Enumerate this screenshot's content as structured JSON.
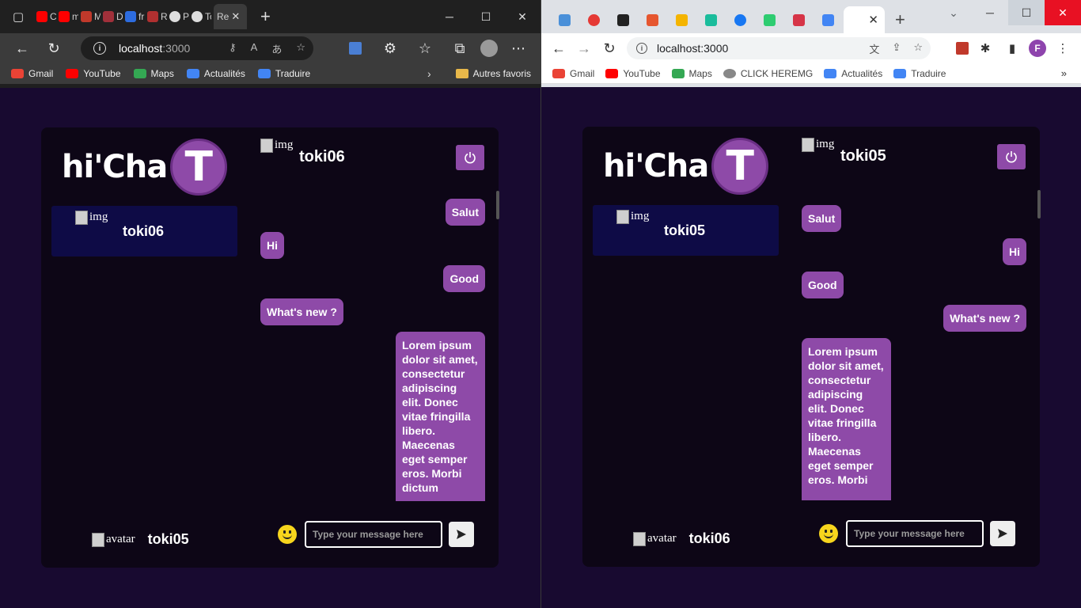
{
  "edge": {
    "tabs": [
      {
        "label": "Cc",
        "color": "#ff0000"
      },
      {
        "label": "m",
        "color": "#ff0000"
      },
      {
        "label": "M",
        "color": "#c0392b"
      },
      {
        "label": "D",
        "color": "#a0303a"
      },
      {
        "label": "fr",
        "color": "#2d6cdf"
      },
      {
        "label": "Re",
        "color": "#b03030"
      },
      {
        "label": "Pa",
        "color": "#dddddd"
      },
      {
        "label": "To",
        "color": "#dddddd"
      }
    ],
    "active_tab": "Re",
    "url_host": "localhost",
    "url_port": ":3000",
    "bookmarks": [
      {
        "label": "Gmail",
        "color": "#ea4335"
      },
      {
        "label": "YouTube",
        "color": "#ff0000"
      },
      {
        "label": "Maps",
        "color": "#34a853"
      },
      {
        "label": "Actualités",
        "color": "#4285f4"
      },
      {
        "label": "Traduire",
        "color": "#4285f4"
      }
    ],
    "other_favorites": "Autres favoris"
  },
  "chrome": {
    "tab_colors": [
      "#4a90d9",
      "#e53935",
      "#222222",
      "#e6562f",
      "#f4b400",
      "#1abc9c",
      "#1877f2",
      "#2ecc71",
      "#d63447",
      "#4285f4"
    ],
    "url": "localhost:3000",
    "profile_initial": "F",
    "bookmarks": [
      {
        "label": "Gmail",
        "color": "#ea4335"
      },
      {
        "label": "YouTube",
        "color": "#ff0000"
      },
      {
        "label": "Maps",
        "color": "#34a853"
      },
      {
        "label": "CLICK HEREMG",
        "color": "#888888"
      },
      {
        "label": "Actualités",
        "color": "#4285f4"
      },
      {
        "label": "Traduire",
        "color": "#4285f4"
      }
    ]
  },
  "app": {
    "logo_text": "hi'Cha",
    "logo_letter": "T",
    "img_alt": "img",
    "avatar_alt": "avatar",
    "input_placeholder": "Type your message here",
    "accent": "#8e4aa8",
    "contact_bg": "#0e0b46"
  },
  "left_chat": {
    "contact": "toki06",
    "current_user": "toki05",
    "header_user": "toki06",
    "messages": [
      {
        "text": "Salut",
        "side": "right"
      },
      {
        "text": "Hi",
        "side": "left"
      },
      {
        "text": "Good",
        "side": "right"
      },
      {
        "text": "What's new ?",
        "side": "left"
      },
      {
        "text": "Lorem ipsum dolor sit amet, consectetur adipiscing elit. Donec vitae fringilla libero. Maecenas eget semper eros. Morbi dictum",
        "side": "right"
      }
    ]
  },
  "right_chat": {
    "contact": "toki05",
    "current_user": "toki06",
    "header_user": "toki05",
    "messages": [
      {
        "text": "Salut",
        "side": "left"
      },
      {
        "text": "Hi",
        "side": "right"
      },
      {
        "text": "Good",
        "side": "left"
      },
      {
        "text": "What's new ?",
        "side": "right"
      },
      {
        "text": "Lorem ipsum dolor sit amet, consectetur adipiscing elit. Donec vitae fringilla libero. Maecenas eget semper eros. Morbi",
        "side": "left"
      }
    ]
  }
}
